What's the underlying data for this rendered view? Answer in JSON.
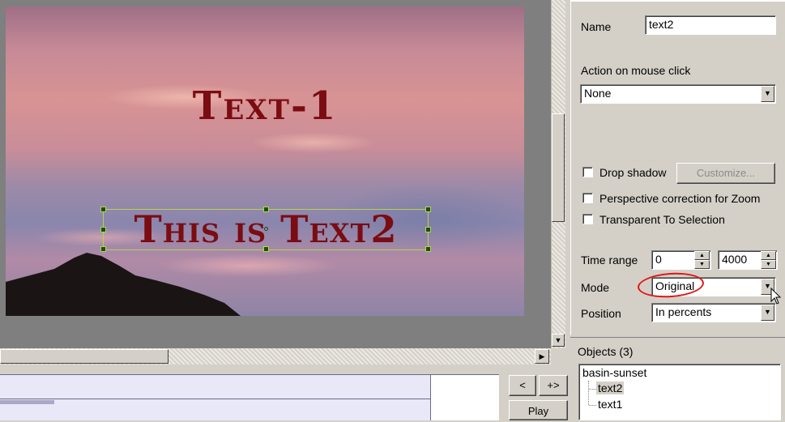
{
  "canvas": {
    "text1": "Text-1",
    "text2": "This is Text2"
  },
  "properties": {
    "name_label": "Name",
    "name_value": "text2",
    "action_label": "Action on mouse click",
    "action_value": "None",
    "drop_shadow_label": "Drop shadow",
    "drop_shadow_checked": false,
    "customize_label": "Customize...",
    "perspective_label": "Perspective correction for Zoom",
    "perspective_checked": false,
    "transparent_label": "Transparent To Selection",
    "transparent_checked": false,
    "time_range_label": "Time range",
    "time_range_start": "0",
    "time_range_end": "4000",
    "mode_label": "Mode",
    "mode_value": "Original",
    "position_label": "Position",
    "position_value": "In percents"
  },
  "objects": {
    "title": "Objects (3)",
    "tree": {
      "root": "basin-sunset",
      "children": [
        "text2",
        "text1"
      ],
      "selected": "text2"
    }
  },
  "playback": {
    "prev_label": "<",
    "next_label": "+>",
    "play_label": "Play"
  },
  "colors": {
    "text_color": "#7a0c12",
    "selection_color": "#b7d24a",
    "highlight_circle": "#e01515"
  }
}
